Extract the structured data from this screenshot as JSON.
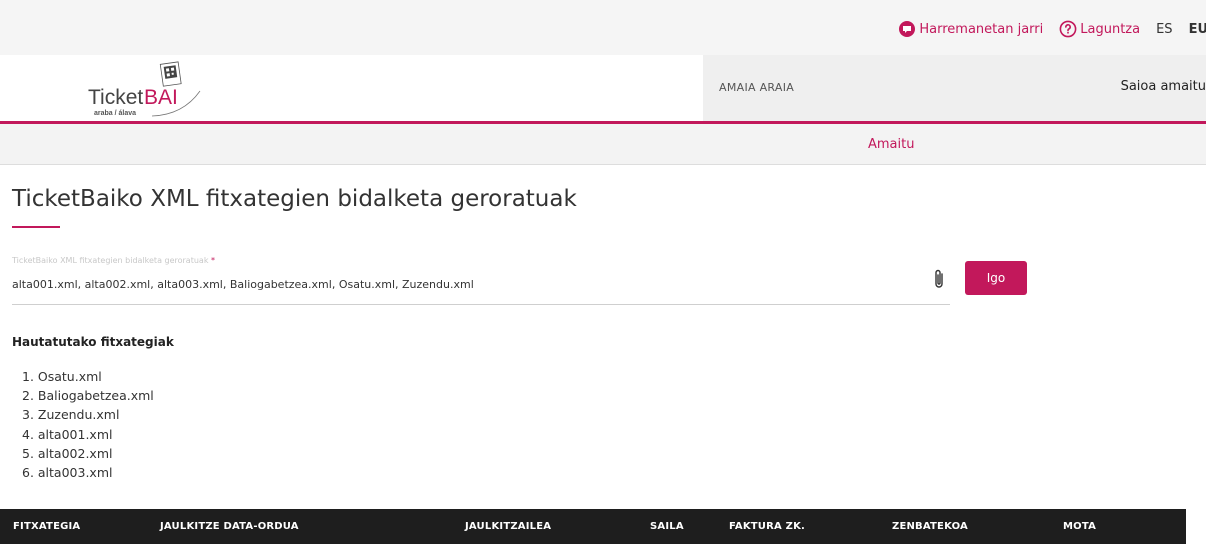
{
  "topbar": {
    "contact_label": "Harremanetan jarri",
    "help_label": "Laguntza",
    "languages": [
      "ES",
      "EU"
    ]
  },
  "header": {
    "logo": {
      "text_main": "Ticket",
      "text_accent": "BAI",
      "subtitle": "araba / álava"
    },
    "user_name": "AMAIA ARAIA",
    "logout_label": "Saioa amaitu"
  },
  "nav": {
    "items": [
      {
        "label": "Amaitu"
      }
    ]
  },
  "page": {
    "title": "TicketBaiko XML fitxategien bidalketa geroratuak"
  },
  "upload": {
    "label": "TicketBaiko XML fitxategien bidalketa geroratuak",
    "required_mark": "*",
    "value": "alta001.xml, alta002.xml, alta003.xml, Baliogabetzea.xml, Osatu.xml, Zuzendu.xml",
    "button_label": "Igo"
  },
  "selected": {
    "heading": "Hautatutako fitxategiak",
    "files": [
      "1. Osatu.xml",
      "2. Baliogabetzea.xml",
      "3. Zuzendu.xml",
      "4. alta001.xml",
      "5. alta002.xml",
      "6. alta003.xml"
    ]
  },
  "table": {
    "columns": [
      "FITXATEGIA",
      "JAULKITZE DATA-ORDUA",
      "JAULKITZAILEA",
      "SAILA",
      "FAKTURA ZK.",
      "ZENBATEKOA",
      "MOTA"
    ]
  },
  "colors": {
    "accent": "#c2185b",
    "table_header_bg": "#1e1e1e"
  },
  "icons": {
    "contact": "chat-bubble-icon",
    "help": "question-circle-icon",
    "attach": "paperclip-icon"
  }
}
